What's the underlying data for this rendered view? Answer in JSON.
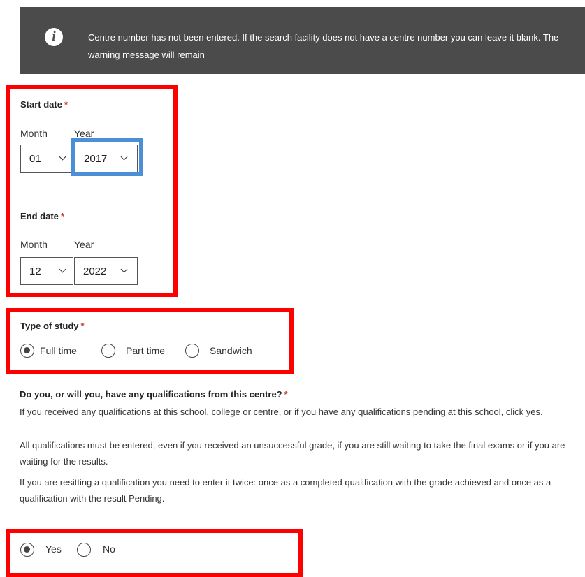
{
  "banner": {
    "icon": "info-icon",
    "message": "Centre number has not been entered. If the search facility does not have a centre number you can leave it blank. The warning message will remain"
  },
  "start_date": {
    "label": "Start date",
    "required": "*",
    "month_label": "Month",
    "year_label": "Year",
    "month_value": "01",
    "year_value": "2017"
  },
  "end_date": {
    "label": "End date",
    "required": "*",
    "month_label": "Month",
    "year_label": "Year",
    "month_value": "12",
    "year_value": "2022"
  },
  "type_of_study": {
    "label": "Type of study",
    "required": "*",
    "options": [
      "Full time",
      "Part time",
      "Sandwich"
    ],
    "selected": "Full time"
  },
  "qualifications": {
    "question": "Do you, or will you, have any qualifications from this centre?",
    "required": "*",
    "para1": "If you received any qualifications at this school, college or centre, or if you have any qualifications pending at this school, click yes.",
    "para2": "All qualifications must be entered, even if you received an unsuccessful grade, if you are still waiting to take the final exams or if you are waiting for the results.",
    "para3": "If you are resitting a qualification you need to enter it twice: once as a completed qualification with the grade achieved and once as a qualification with the result Pending.",
    "options": [
      "Yes",
      "No"
    ],
    "selected": "Yes"
  },
  "colors": {
    "banner_bg": "#4b4b4b",
    "highlight_red": "#ff0000",
    "highlight_blue": "#4d8fd6",
    "required": "#c0392b"
  }
}
